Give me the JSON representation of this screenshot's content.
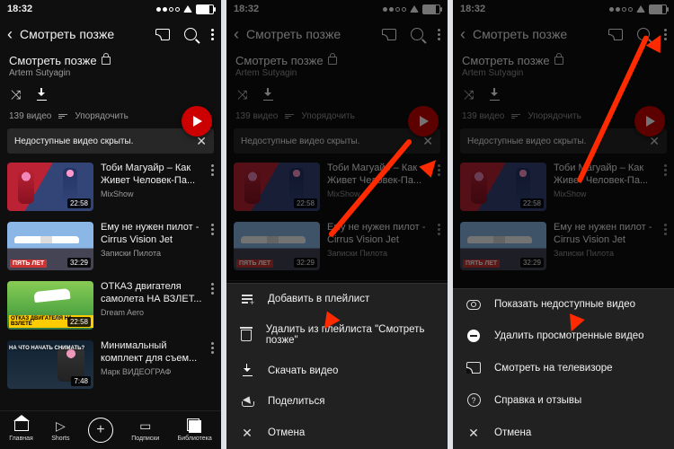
{
  "status": {
    "time": "18:32"
  },
  "header": {
    "title": "Смотреть позже"
  },
  "playlist": {
    "name": "Смотреть позже",
    "author": "Artem Sutyagin",
    "count_label": "139 видео",
    "sort_label": "Упорядочить",
    "banner": "Недоступные видео скрыты."
  },
  "videos": [
    {
      "title": "Тоби Магуайр – Как Живет Человек-Па...",
      "channel": "MixShow",
      "duration": "22:58",
      "thumb_label": ""
    },
    {
      "title": "Ему не нужен пилот - Cirrus Vision Jet",
      "channel": "Записки Пилота",
      "duration": "32:29",
      "thumb_label": "ПЯТЬ ЛЕТ"
    },
    {
      "title": "ОТКАЗ двигателя самолета НА ВЗЛЕТ...",
      "channel": "Dream Aero",
      "duration": "22:58",
      "thumb_label": "ОТКАЗ ДВИГАТЕЛЯ\nНА ВЗЛЕТЕ"
    },
    {
      "title": "Минимальный комплект для съем...",
      "channel": "Марк ВИДЕОГРАФ",
      "duration": "7:48",
      "thumb_label": "НА ЧТО\nНАЧАТЬ\nСНИМАТЬ?"
    }
  ],
  "videos_short": [
    {
      "title": "Тоби Магуайр – Как Живет Человек-Па...",
      "channel": "MixShow",
      "duration": "22:58"
    },
    {
      "title": "Ему не нужен пилот - Cirrus Vision Jet",
      "channel": "Записки Пилота",
      "duration": "32:29"
    },
    {
      "title_short": "ОТКАЗ двигателя"
    }
  ],
  "nav": {
    "home": "Главная",
    "shorts": "Shorts",
    "subs": "Подписки",
    "library": "Библиотека"
  },
  "sheet_item": {
    "add": "Добавить в плейлист",
    "remove": "Удалить из плейлиста \"Смотреть позже\"",
    "download": "Скачать видео",
    "share": "Поделиться",
    "cancel": "Отмена"
  },
  "sheet_page": {
    "show_unavail": "Показать недоступные видео",
    "del_watched": "Удалить просмотренные видео",
    "cast": "Смотреть на телевизоре",
    "help": "Справка и отзывы",
    "cancel": "Отмена"
  }
}
